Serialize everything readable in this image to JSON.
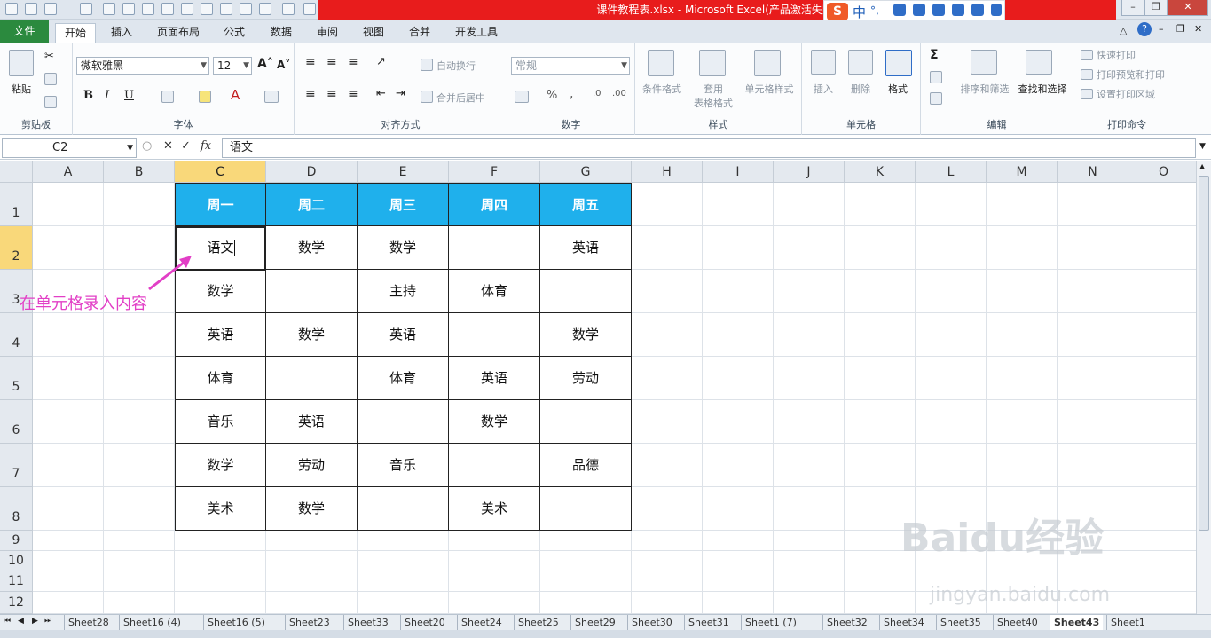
{
  "window": {
    "title": "课件教程表.xlsx - Microsoft Excel(产品激活失败)"
  },
  "ime": {
    "logo": "S",
    "mode": "中",
    "punct": "°,"
  },
  "ribbon_tabs": [
    "文件",
    "开始",
    "插入",
    "页面布局",
    "公式",
    "数据",
    "审阅",
    "视图",
    "合并",
    "开发工具"
  ],
  "active_tab": "开始",
  "ribbon": {
    "clipboard": {
      "paste": "粘贴",
      "label": "剪贴板"
    },
    "font": {
      "name": "微软雅黑",
      "size": "12",
      "bold": "B",
      "italic": "I",
      "underline": "U",
      "label": "字体"
    },
    "align": {
      "wrap": "自动换行",
      "merge": "合并后居中",
      "label": "对齐方式"
    },
    "number": {
      "format": "常规",
      "percent": "%",
      "comma": ",",
      "label": "数字"
    },
    "styles": {
      "conditional": "条件格式",
      "table1": "套用",
      "table2": "表格格式",
      "cell": "单元格样式",
      "label": "样式"
    },
    "cells": {
      "insert": "插入",
      "delete": "删除",
      "format": "格式",
      "label": "单元格"
    },
    "edit": {
      "sum": "Σ",
      "sort": "排序和筛选",
      "find": "查找和选择",
      "label": "编辑"
    },
    "print": {
      "quick": "快速打印",
      "preview": "打印预览和打印",
      "area": "设置打印区域",
      "label": "打印命令"
    }
  },
  "formula_bar": {
    "name_box": "C2",
    "fx": "fx",
    "value": "语文"
  },
  "columns": [
    "A",
    "B",
    "C",
    "D",
    "E",
    "F",
    "G",
    "H",
    "I",
    "J",
    "K",
    "L",
    "M",
    "N",
    "O"
  ],
  "selected_column": "C",
  "rows": [
    "1",
    "2",
    "3",
    "4",
    "5",
    "6",
    "7",
    "8",
    "9",
    "10",
    "11",
    "12"
  ],
  "selected_row": "2",
  "table": {
    "headers": [
      "周一",
      "周二",
      "周三",
      "周四",
      "周五"
    ],
    "rows": [
      [
        "语文",
        "数学",
        "数学",
        "",
        "英语"
      ],
      [
        "数学",
        "",
        "主持",
        "体育",
        ""
      ],
      [
        "英语",
        "数学",
        "英语",
        "",
        "数学"
      ],
      [
        "体育",
        "",
        "体育",
        "英语",
        "劳动"
      ],
      [
        "音乐",
        "英语",
        "",
        "数学",
        ""
      ],
      [
        "数学",
        "劳动",
        "音乐",
        "",
        "品德"
      ],
      [
        "美术",
        "数学",
        "",
        "美术",
        ""
      ]
    ]
  },
  "annotation": "在单元格录入内容",
  "sheet_tabs": [
    "Sheet28",
    "Sheet16 (4)",
    "Sheet16 (5)",
    "Sheet23",
    "Sheet33",
    "Sheet20",
    "Sheet24",
    "Sheet25",
    "Sheet29",
    "Sheet30",
    "Sheet31",
    "Sheet1 (7)",
    "Sheet32",
    "Sheet34",
    "Sheet35",
    "Sheet40",
    "Sheet43",
    "Sheet1"
  ],
  "active_sheet": "Sheet43",
  "watermark": {
    "brand": "Baidu经验",
    "url": "jingyan.baidu.com"
  },
  "colors": {
    "header_fill": "#1fb0ec",
    "annotation": "#e23fc6",
    "title_bar": "#e81c1c",
    "file_tab": "#2b8a3e"
  }
}
